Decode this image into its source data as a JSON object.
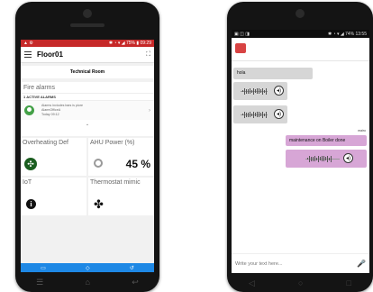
{
  "left_phone": {
    "status_bar": {
      "left_icons": "▲ ⚙",
      "right": "✱ ◔ ▾ ◢ 75% ▮ 09:29"
    },
    "app_bar": {
      "title": "Floor01",
      "menu_icon": "hamburger-icon",
      "expand_icon": "expand-icon"
    },
    "room_header": "Technical Room",
    "fire_alarms": {
      "heading": "Fire alarms",
      "active_label": "1 ACTIVE ALARMS",
      "alarm_line1": "Alarms inviodes bars is piore",
      "alarm_line2": "AlarmOfficeA",
      "alarm_line3": "Today 09:12"
    },
    "tiles": [
      {
        "label": "Overheating Def",
        "icon": "fan-green-icon"
      },
      {
        "label": "AHU Power (%)",
        "value": "45 %",
        "icon": "gauge-icon"
      },
      {
        "label": "IoT",
        "icon": "info-icon"
      },
      {
        "label": "Thermostat mimic",
        "icon": "fan-icon"
      }
    ],
    "colors": {
      "status_bar": "#c62828",
      "accent": "#1e88e5"
    }
  },
  "right_phone": {
    "status_bar": {
      "left_icons": "▣ ◫ ◨",
      "right": "✱ ◔ ▾ ◢ 74% 13:55"
    },
    "messages": [
      {
        "direction": "in",
        "text": "hola"
      },
      {
        "direction": "in",
        "audio": true
      },
      {
        "direction": "in",
        "audio": true
      },
      {
        "direction": "out",
        "sender": "mairo",
        "text": "maintenance on Boiler done"
      },
      {
        "direction": "out",
        "audio": true
      }
    ],
    "composer": {
      "placeholder": "Write your text here...",
      "mic_icon": "mic-icon"
    },
    "colors": {
      "incoming": "#d6d6d6",
      "outgoing": "#d7a6d6"
    }
  }
}
